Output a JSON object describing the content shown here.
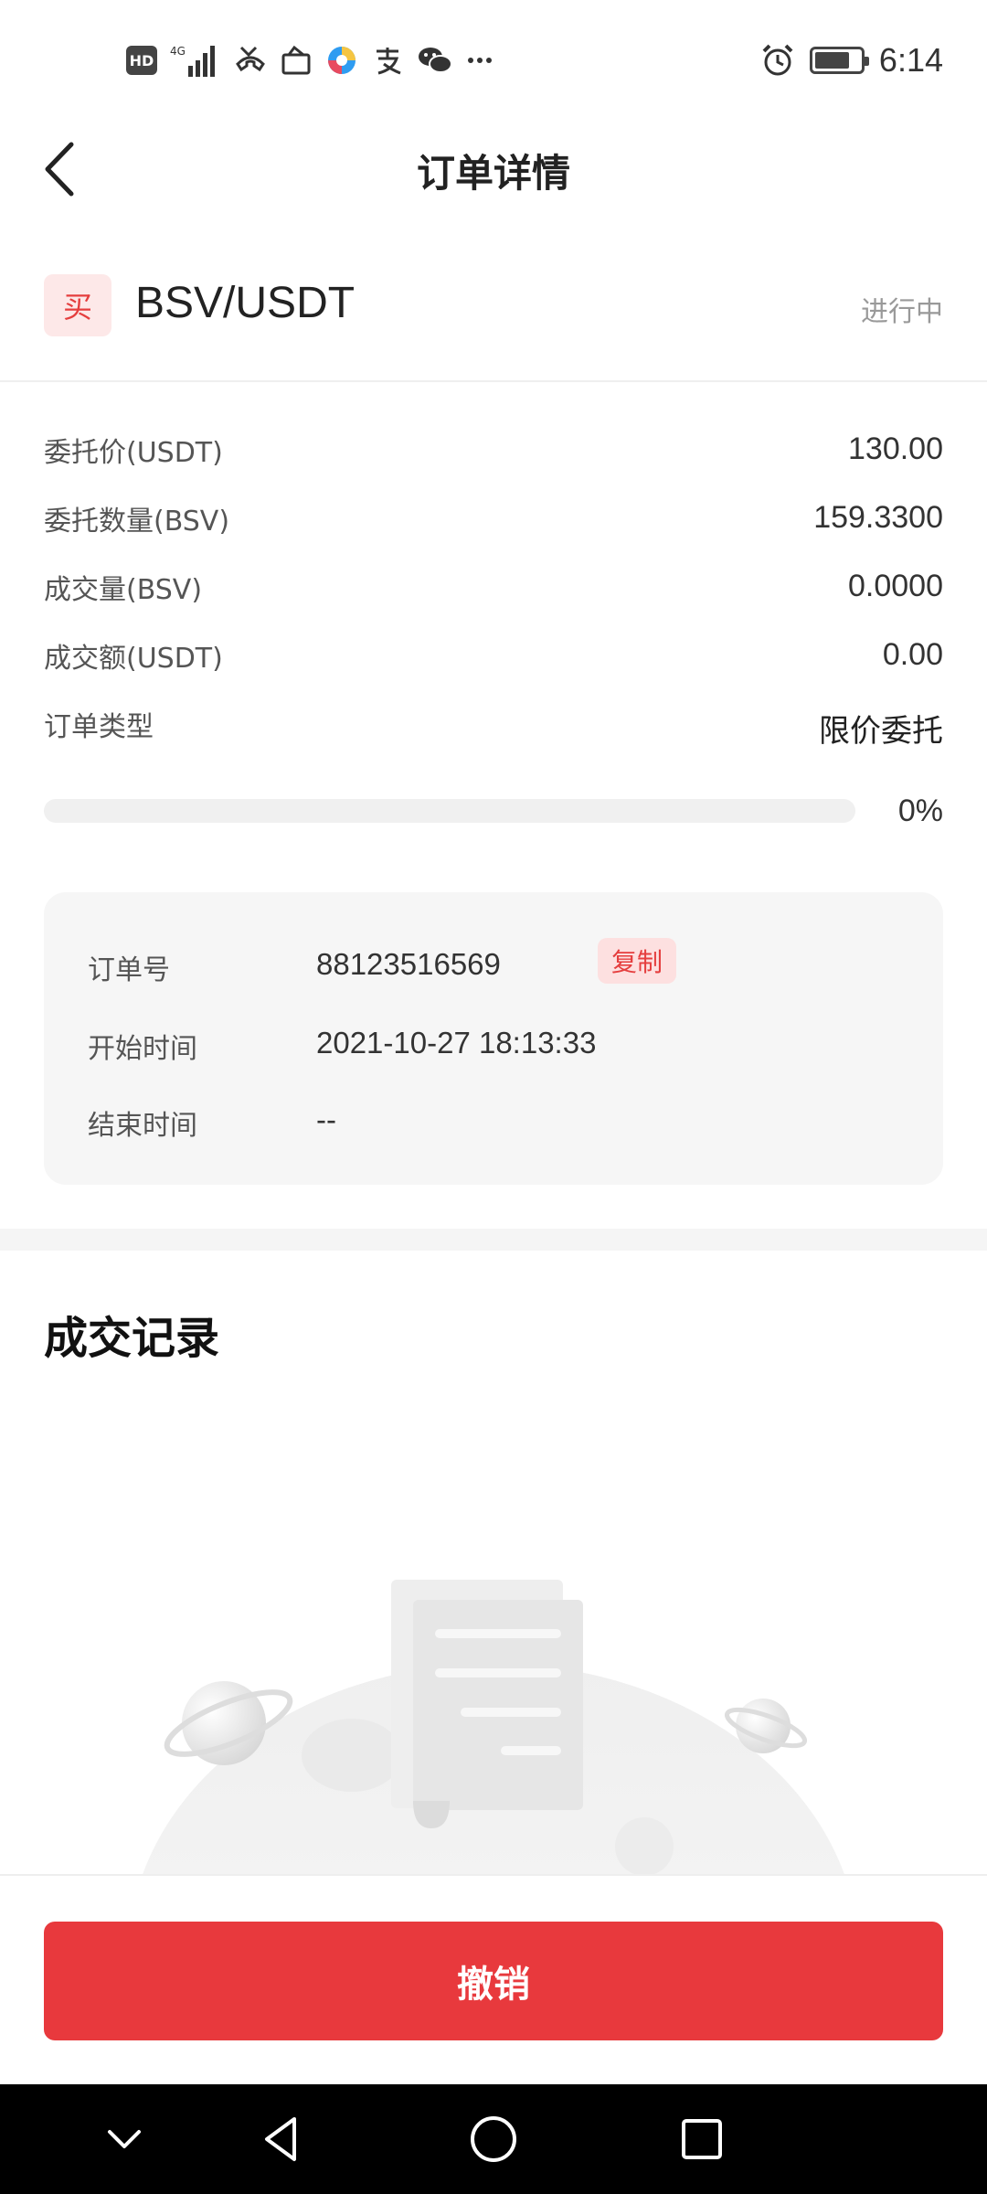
{
  "status_bar": {
    "hd_label": "HD",
    "network_label": "4G",
    "time": "6:14",
    "icons": [
      "hd-icon",
      "signal-icon",
      "missed-call-icon",
      "bag-icon",
      "app-icon",
      "alipay-icon",
      "wechat-icon",
      "more-icon",
      "alarm-icon",
      "battery-icon"
    ]
  },
  "header": {
    "title": "订单详情"
  },
  "order": {
    "side_label": "买",
    "pair": "BSV/USDT",
    "status": "进行中",
    "details": [
      {
        "label": "委托价(USDT)",
        "value": "130.00"
      },
      {
        "label": "委托数量(BSV)",
        "value": "159.3300"
      },
      {
        "label": "成交量(BSV)",
        "value": "0.0000"
      },
      {
        "label": "成交额(USDT)",
        "value": "0.00"
      },
      {
        "label": "订单类型",
        "value": "限价委托"
      }
    ],
    "progress_percent": 0,
    "progress_label": "0%"
  },
  "info_card": {
    "order_no_label": "订单号",
    "order_no_value": "88123516569",
    "copy_label": "复制",
    "start_label": "开始时间",
    "start_value": "2021-10-27 18:13:33",
    "end_label": "结束时间",
    "end_value": "--"
  },
  "trades": {
    "title": "成交记录"
  },
  "actions": {
    "cancel_label": "撤销"
  },
  "colors": {
    "accent": "#e8393d",
    "badge_bg": "#fde8e8",
    "card_bg": "#f6f6f6"
  },
  "nav": {
    "icons": [
      "collapse-icon",
      "back-icon",
      "home-icon",
      "recents-icon"
    ]
  }
}
